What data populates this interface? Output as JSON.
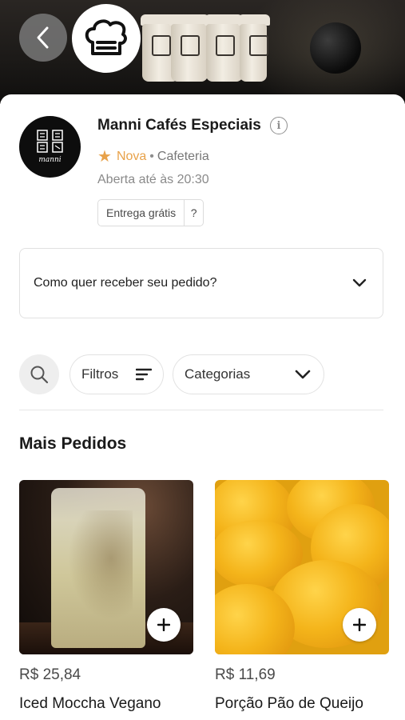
{
  "header": {
    "back_label": "Voltar",
    "badge_icon": "chef-hat-icon"
  },
  "store": {
    "name": "Manni Cafés Especiais",
    "logo_text": "manni",
    "rating_label": "Nova",
    "category": "Cafeteria",
    "separator": "•",
    "hours": "Aberta até às 20:30",
    "delivery_tag": "Entrega grátis",
    "delivery_help": "?"
  },
  "receive": {
    "prompt": "Como quer receber seu pedido?"
  },
  "filters": {
    "filtros_label": "Filtros",
    "categorias_label": "Categorias"
  },
  "section": {
    "title": "Mais Pedidos"
  },
  "products": [
    {
      "price": "R$ 25,84",
      "name": "Iced Moccha Vegano"
    },
    {
      "price": "R$ 11,69",
      "name": "Porção Pão de Queijo"
    }
  ],
  "colors": {
    "accent": "#e8a24a",
    "text": "#1a1a1a",
    "muted": "#8a8a8a",
    "border": "#e1e1e1"
  }
}
